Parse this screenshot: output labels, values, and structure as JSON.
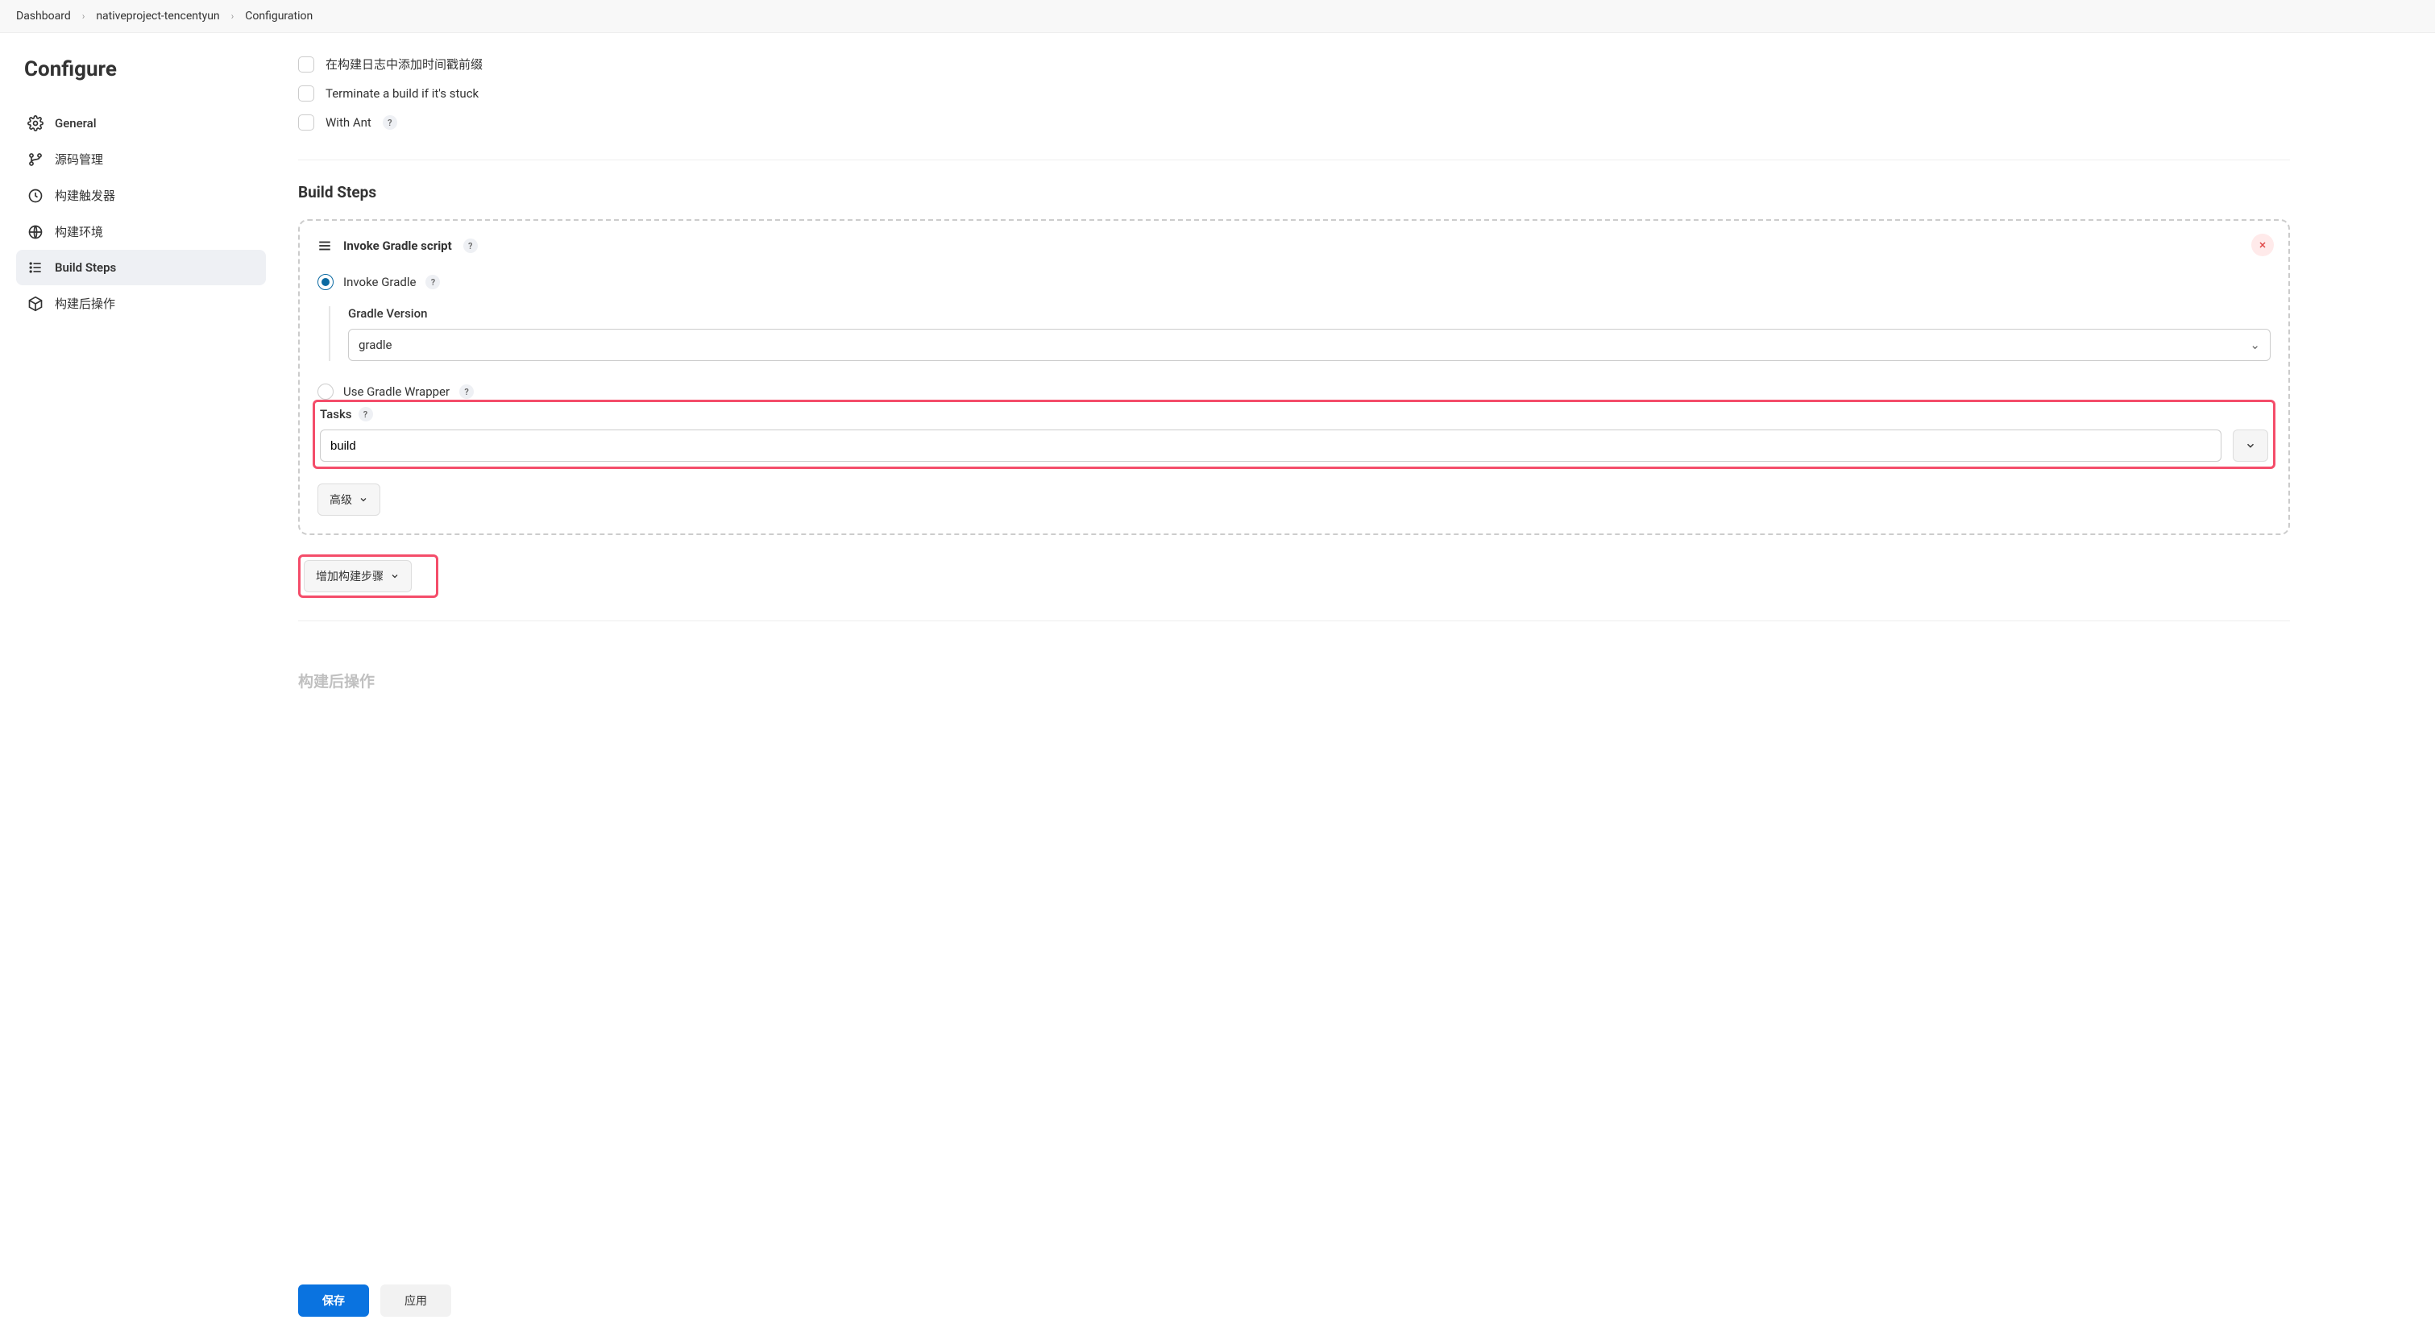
{
  "breadcrumb": {
    "items": [
      "Dashboard",
      "nativeproject-tencentyun",
      "Configuration"
    ]
  },
  "page_title": "Configure",
  "sidebar": {
    "items": [
      {
        "label": "General",
        "icon": "gear"
      },
      {
        "label": "源码管理",
        "icon": "branch"
      },
      {
        "label": "构建触发器",
        "icon": "clock"
      },
      {
        "label": "构建环境",
        "icon": "globe"
      },
      {
        "label": "Build Steps",
        "icon": "list",
        "active": true
      },
      {
        "label": "构建后操作",
        "icon": "cube"
      }
    ]
  },
  "env_checks": [
    {
      "label": "在构建日志中添加时间戳前缀",
      "help": false
    },
    {
      "label": "Terminate a build if it's stuck",
      "help": false
    },
    {
      "label": "With Ant",
      "help": true
    }
  ],
  "build_steps": {
    "heading": "Build Steps",
    "step": {
      "title": "Invoke Gradle script",
      "opt_invoke": "Invoke Gradle",
      "gradle_version_label": "Gradle Version",
      "gradle_version_value": "gradle",
      "opt_wrapper": "Use Gradle Wrapper",
      "tasks_label": "Tasks",
      "tasks_value": "build",
      "advanced_label": "高级"
    },
    "add_step_label": "增加构建步骤"
  },
  "post_section": "构建后操作",
  "footer": {
    "save": "保存",
    "apply": "应用"
  }
}
